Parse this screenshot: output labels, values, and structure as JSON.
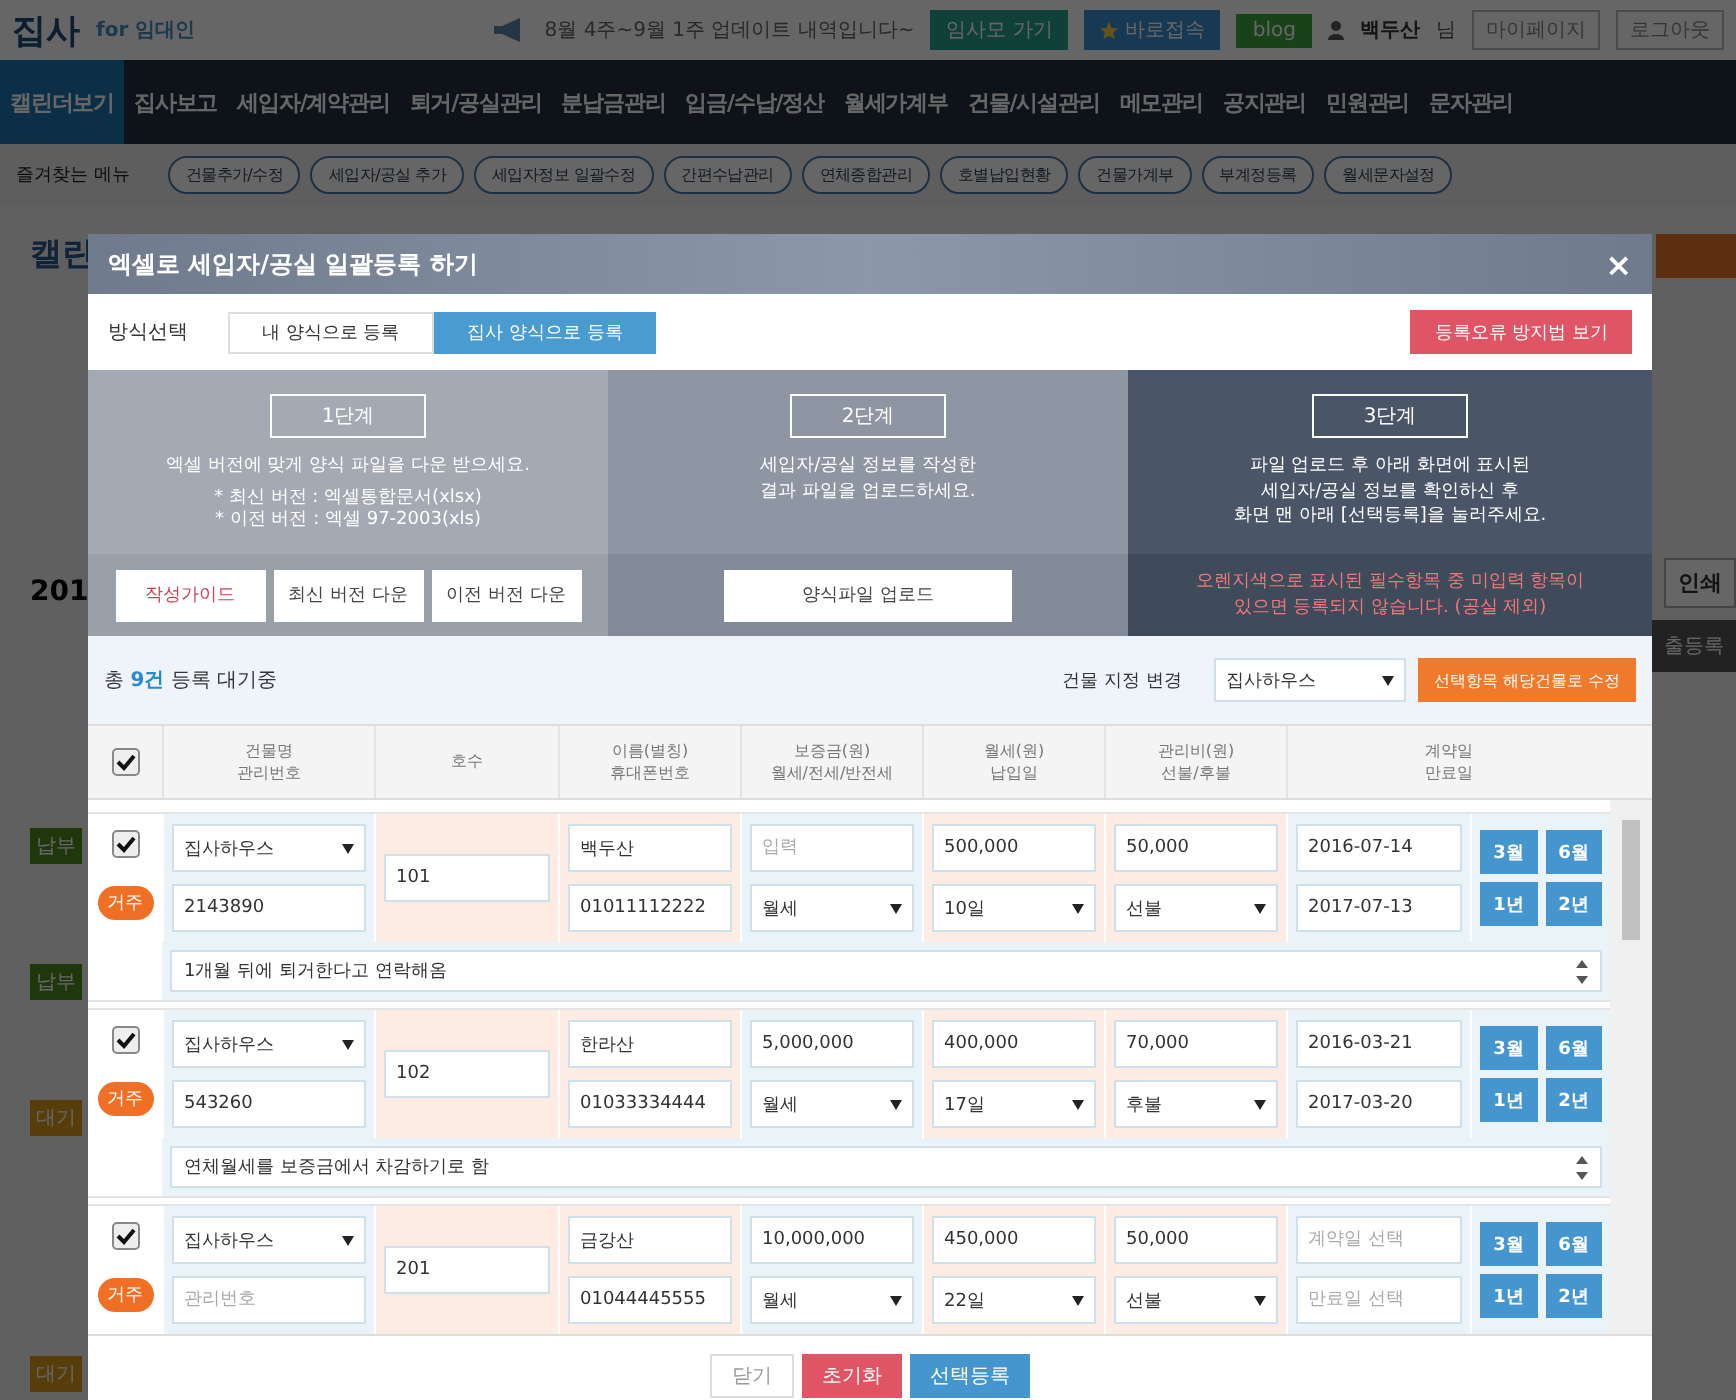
{
  "header": {
    "logo": "집사",
    "logo_sub": "for 임대인",
    "notice": "8월 4주~9월 1주 업데이트 내역입니다~",
    "links": [
      {
        "label": "임사모 가기",
        "kind": "teal"
      },
      {
        "label": "바로접속",
        "kind": "star"
      },
      {
        "label": "blog",
        "kind": "green"
      }
    ],
    "user": "백두산",
    "user_suffix": "님",
    "account_links": [
      "마이페이지",
      "로그아웃"
    ]
  },
  "nav": [
    {
      "label": "캘린더보기",
      "selected": true
    },
    {
      "label": "집사보고",
      "selected": false
    },
    {
      "label": "세입자/계약관리",
      "selected": false
    },
    {
      "label": "퇴거/공실관리",
      "selected": false
    },
    {
      "label": "분납금관리",
      "selected": false
    },
    {
      "label": "입금/수납/정산",
      "selected": false
    },
    {
      "label": "월세가계부",
      "selected": false
    },
    {
      "label": "건물/시설관리",
      "selected": false
    },
    {
      "label": "메모관리",
      "selected": false
    },
    {
      "label": "공지관리",
      "selected": false
    },
    {
      "label": "민원관리",
      "selected": false
    },
    {
      "label": "문자관리",
      "selected": false
    }
  ],
  "favorites": {
    "label": "즐겨찾는 메뉴",
    "items": [
      "건물추가/수정",
      "세입자/공실 추가",
      "세입자정보 일괄수정",
      "간편수납관리",
      "연체종합관리",
      "호별납입현황",
      "건물가계부",
      "부계정등록",
      "월세문자설정"
    ]
  },
  "background": {
    "title": "캘린",
    "year": "201",
    "badges": [
      {
        "label": "납부",
        "kind": "paid"
      },
      {
        "label": "납부",
        "kind": "paid"
      },
      {
        "label": "대기",
        "kind": "waiting"
      },
      {
        "label": "대기",
        "kind": "waiting"
      }
    ],
    "print_button": "인쇄",
    "side_button": "출등록"
  },
  "modal": {
    "title": "엑셀로 세입자/공실 일괄등록 하기",
    "close": "×",
    "method_label": "방식선택",
    "methods": [
      {
        "label": "내 양식으로 등록",
        "selected": false
      },
      {
        "label": "집사 양식으로 등록",
        "selected": true
      }
    ],
    "help_button": "등록오류 방지법 보기",
    "steps": [
      {
        "title": "1단계",
        "text": "엑셀 버전에 맞게 양식 파일을 다운 받으세요.",
        "notes": "* 최신 버전 : 엑셀통합문서(xlsx)\n* 이전 버전 : 엑셀 97-2003(xls)",
        "buttons": [
          {
            "label": "작성가이드",
            "kind": "accent"
          },
          {
            "label": "최신 버전 다운",
            "kind": "plain"
          },
          {
            "label": "이전 버전 다운",
            "kind": "plain"
          }
        ]
      },
      {
        "title": "2단계",
        "text": "세입자/공실 정보를 작성한\n결과 파일을 업로드하세요.",
        "buttons": [
          {
            "label": "양식파일 업로드",
            "kind": "wide"
          }
        ]
      },
      {
        "title": "3단계",
        "text": "파일 업로드 후 아래 화면에 표시된\n세입자/공실 정보를 확인하신 후\n화면 맨 아래 [선택등록]을 눌러주세요.",
        "warning": "오렌지색으로 표시된 필수항목 중 미입력 항목이\n있으면 등록되지 않습니다. (공실 제외)"
      }
    ],
    "summary": "총 **9건** 등록 대기중",
    "building_label": "건물 지정 변경",
    "building_select": "집사하우스",
    "apply_button": "선택항목 해당건물로 수정",
    "all_checked": true,
    "columns": [
      "건물명\n관리번호",
      "호수",
      "이름(별칭)\n휴대폰번호",
      "보증금(원)\n월세/전세/반전세",
      "월세(원)\n납입일",
      "관리비(원)\n선불/후불",
      "계약일\n만료일"
    ],
    "rows": [
      {
        "checked": true,
        "status": "거주",
        "building": "집사하우스",
        "code": {
          "value": "2143890"
        },
        "room": "101",
        "name": "백두산",
        "phone": "01011112222",
        "deposit": {
          "placeholder": "입력"
        },
        "rent_type": "월세",
        "rent": "500,000",
        "pay_day": "10일",
        "fee": "50,000",
        "fee_timing": "선불",
        "start": {
          "value": "2016-07-14"
        },
        "end": {
          "value": "2017-07-13"
        },
        "terms": [
          "3월",
          "6월",
          "1년",
          "2년"
        ],
        "memo": "1개월 뒤에 퇴거한다고 연락해옴"
      },
      {
        "checked": true,
        "status": "거주",
        "building": "집사하우스",
        "code": {
          "value": "543260"
        },
        "room": "102",
        "name": "한라산",
        "phone": "01033334444",
        "deposit": {
          "value": "5,000,000"
        },
        "rent_type": "월세",
        "rent": "400,000",
        "pay_day": "17일",
        "fee": "70,000",
        "fee_timing": "후불",
        "start": {
          "value": "2016-03-21"
        },
        "end": {
          "value": "2017-03-20"
        },
        "terms": [
          "3월",
          "6월",
          "1년",
          "2년"
        ],
        "memo": "연체월세를 보증금에서 차감하기로 함"
      },
      {
        "checked": true,
        "status": "거주",
        "building": "집사하우스",
        "code": {
          "placeholder": "관리번호"
        },
        "room": "201",
        "name": "금강산",
        "phone": "01044445555",
        "deposit": {
          "value": "10,000,000"
        },
        "rent_type": "월세",
        "rent": "450,000",
        "pay_day": "22일",
        "fee": "50,000",
        "fee_timing": "선불",
        "start": {
          "placeholder": "계약일 선택"
        },
        "end": {
          "placeholder": "만료일 선택"
        },
        "terms": [
          "3월",
          "6월",
          "1년",
          "2년"
        ]
      }
    ],
    "footer_buttons": [
      {
        "label": "닫기",
        "kind": "plain"
      },
      {
        "label": "초기화",
        "kind": "danger"
      },
      {
        "label": "선택등록",
        "kind": "primary"
      }
    ]
  }
}
